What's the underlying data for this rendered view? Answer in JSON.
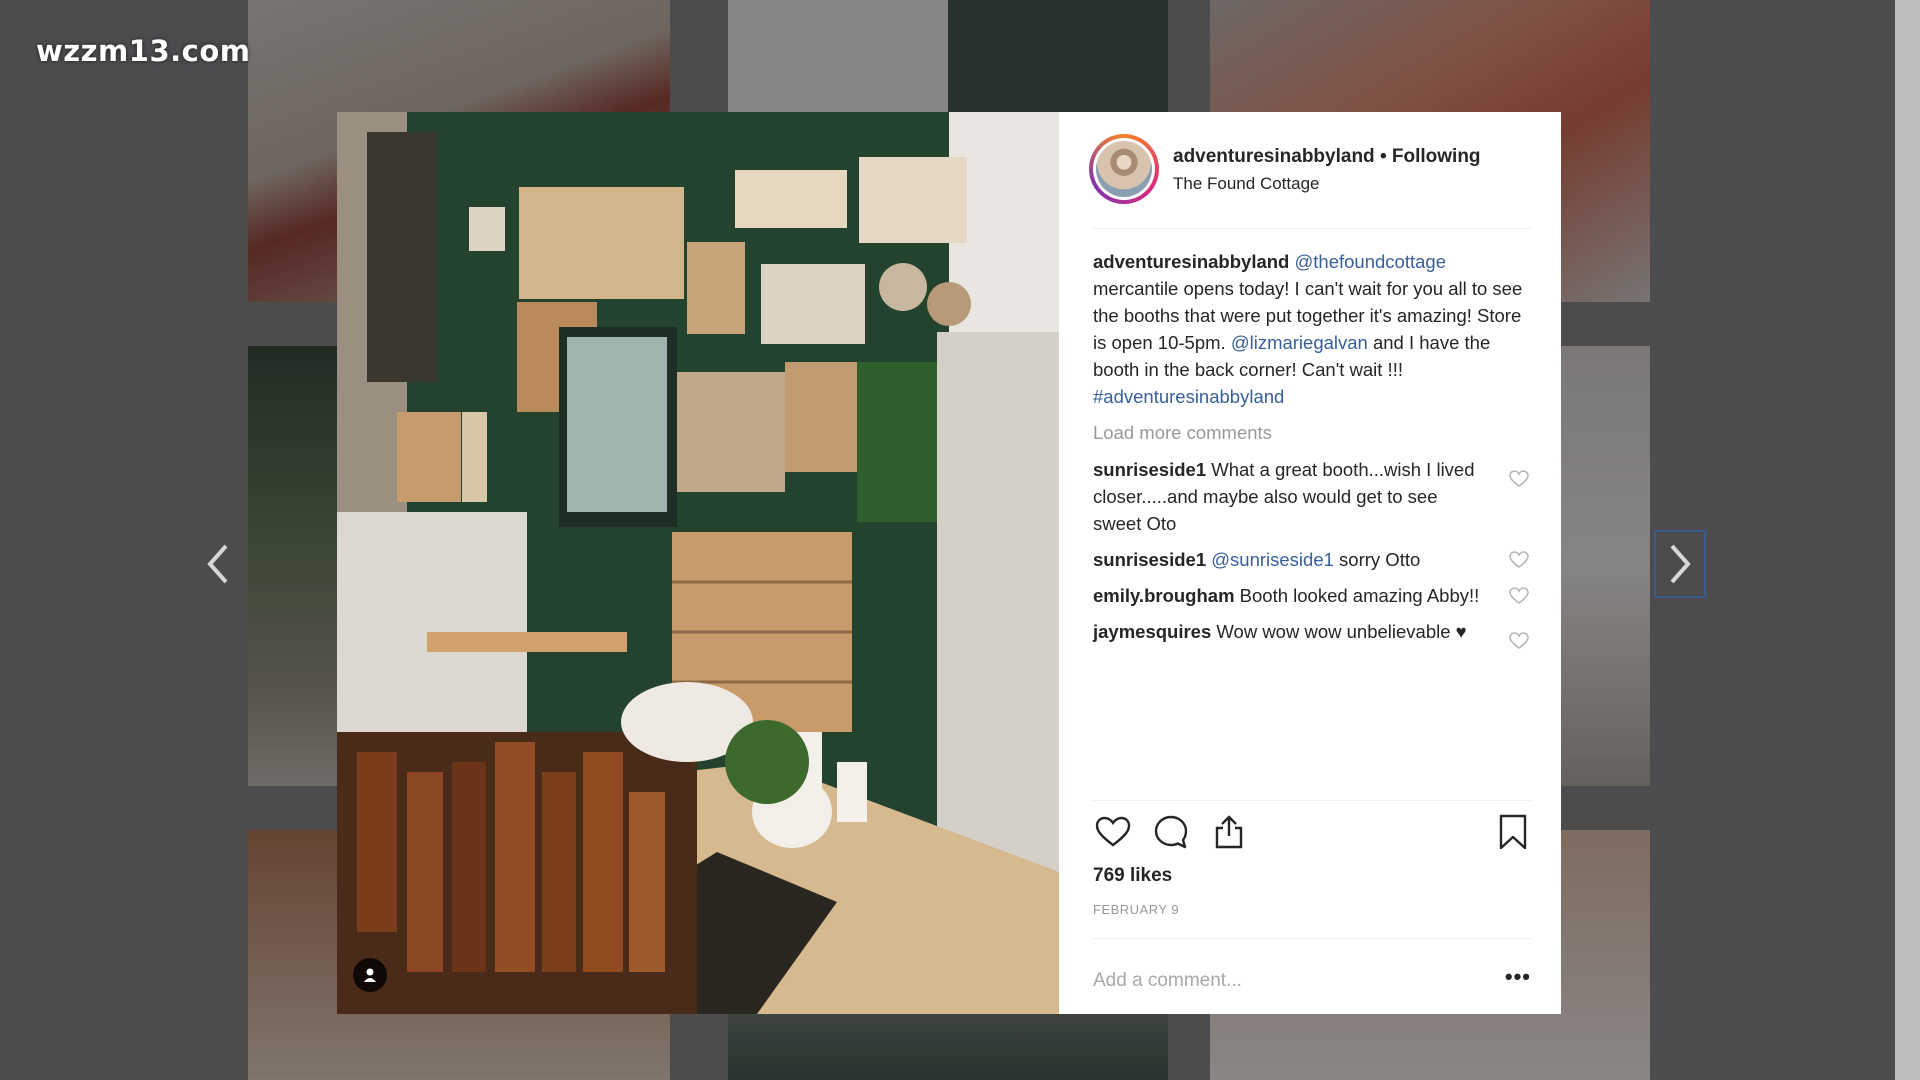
{
  "watermark": "wzzm13.com",
  "colors": {
    "accent_link": "#385f9a",
    "text": "#262626",
    "muted": "#999999",
    "wall_green": "#24432f"
  },
  "icons": [
    "chevron-left-icon",
    "chevron-right-icon",
    "heart-icon",
    "comment-icon",
    "share-icon",
    "bookmark-icon",
    "user-tag-icon",
    "more-options-icon"
  ],
  "post": {
    "header": {
      "username": "adventuresinabbyland",
      "follow_status": "• Following",
      "location": "The Found Cottage"
    },
    "caption": {
      "username": "adventuresinabbyland",
      "mention1": "@thefoundcottage",
      "text1": " mercantile opens today! I can't wait for you all to see the booths that were put together it's amazing! Store is open 10-5pm. ",
      "mention2": "@lizmariegalvan",
      "text2": " and I have the booth in the back corner! Can't wait !!! ",
      "hashtag": "#adventuresinabbyland"
    },
    "load_more": "Load more comments",
    "comments": [
      {
        "user": "sunriseside1",
        "mention": "",
        "text": " What a great booth...wish I lived closer.....and maybe also would get to see sweet Oto"
      },
      {
        "user": "sunriseside1",
        "mention": " @sunriseside1",
        "text": " sorry Otto"
      },
      {
        "user": "emily.brougham",
        "mention": "",
        "text": " Booth looked amazing Abby!!"
      },
      {
        "user": "jaymesquires",
        "mention": "",
        "text": " Wow wow wow unbelievable ♥"
      }
    ],
    "likes": "769 likes",
    "date": "FEBRUARY 9",
    "comment_placeholder": "Add a comment...",
    "more_options": "•••"
  }
}
